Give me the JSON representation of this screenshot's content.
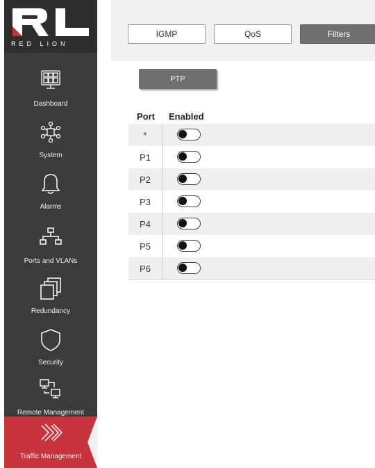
{
  "brand": {
    "logo_text": "RED LION"
  },
  "sidebar": {
    "items": [
      {
        "label": "Dashboard",
        "icon": "dashboard-icon"
      },
      {
        "label": "System",
        "icon": "system-icon"
      },
      {
        "label": "Alarms",
        "icon": "bell-icon"
      },
      {
        "label": "Ports and VLANs",
        "icon": "network-icon"
      },
      {
        "label": "Redundancy",
        "icon": "stacked-windows-icon"
      },
      {
        "label": "Security",
        "icon": "shield-icon"
      },
      {
        "label": "Remote Management",
        "icon": "remote-computers-icon"
      },
      {
        "label": "Traffic Management",
        "icon": "double-chevron-icon",
        "active": true
      }
    ]
  },
  "tabs": {
    "igmp": "IGMP",
    "qos": "QoS",
    "filters": "Filters",
    "active": "Filters"
  },
  "subtabs": {
    "ptp": "PTP"
  },
  "table": {
    "headers": {
      "port": "Port",
      "enabled": "Enabled"
    },
    "rows": [
      {
        "port": "*",
        "enabled": false
      },
      {
        "port": "P1",
        "enabled": false
      },
      {
        "port": "P2",
        "enabled": false
      },
      {
        "port": "P3",
        "enabled": false
      },
      {
        "port": "P4",
        "enabled": false
      },
      {
        "port": "P5",
        "enabled": false
      },
      {
        "port": "P6",
        "enabled": false
      }
    ]
  },
  "colors": {
    "sidebar_bg": "#3b3b3b",
    "active_nav": "#c8343b",
    "selected_tab": "#6f6f6f"
  }
}
